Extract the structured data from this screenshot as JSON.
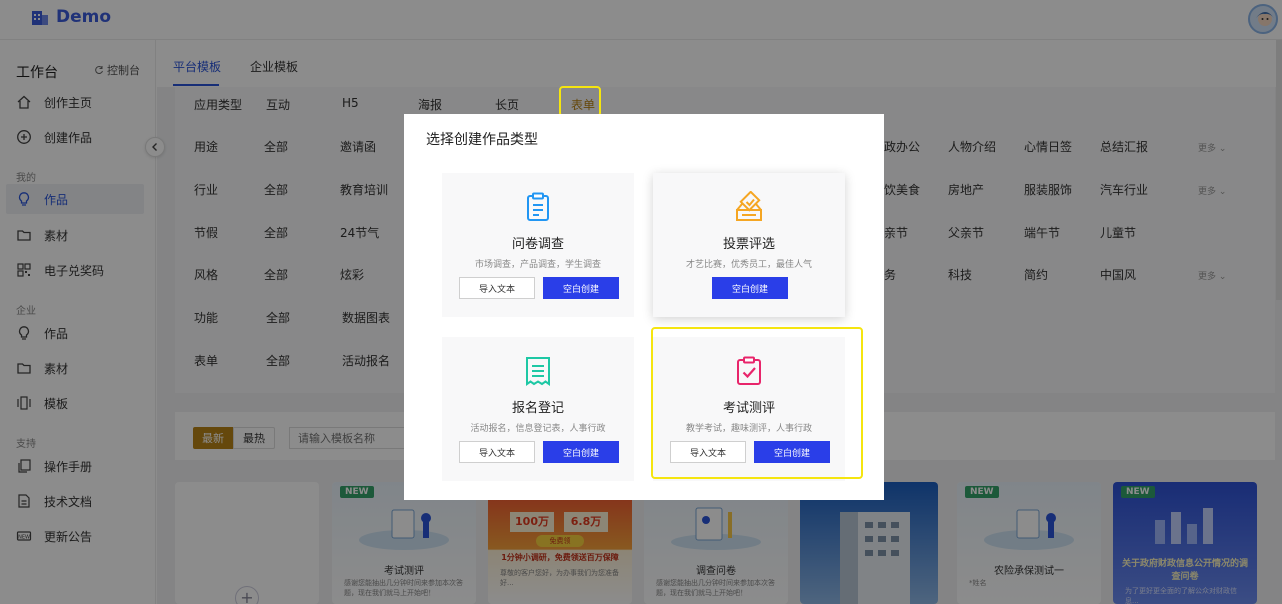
{
  "app": {
    "name": "Demo"
  },
  "sidebar": {
    "workspace_title": "工作台",
    "console_label": "控制台",
    "items_top": [
      {
        "label": "创作主页",
        "icon": "home-icon"
      },
      {
        "label": "创建作品",
        "icon": "plus-circle-icon"
      }
    ],
    "group_mine": "我的",
    "items_mine": [
      {
        "label": "作品",
        "icon": "bulb-icon",
        "active": true
      },
      {
        "label": "素材",
        "icon": "folder-icon"
      },
      {
        "label": "电子兑奖码",
        "icon": "qrcode-icon"
      }
    ],
    "group_enterprise": "企业",
    "items_enterprise": [
      {
        "label": "作品",
        "icon": "bulb-icon"
      },
      {
        "label": "素材",
        "icon": "folder-icon"
      },
      {
        "label": "模板",
        "icon": "template-icon"
      }
    ],
    "group_support": "支持",
    "items_support": [
      {
        "label": "操作手册",
        "icon": "copy-icon"
      },
      {
        "label": "技术文档",
        "icon": "doc-icon"
      },
      {
        "label": "更新公告",
        "icon": "new-icon"
      }
    ]
  },
  "tabs": [
    {
      "label": "平台模板",
      "active": true
    },
    {
      "label": "企业模板",
      "active": false
    }
  ],
  "filters": {
    "app_type_label": "应用类型",
    "app_types": [
      "互动",
      "H5",
      "海报",
      "长页",
      "表单"
    ],
    "rows": [
      {
        "label": "用途",
        "all": "全部",
        "first": "邀请函",
        "right": [
          "政办公",
          "人物介绍",
          "心情日签",
          "总结汇报"
        ],
        "more": "更多"
      },
      {
        "label": "行业",
        "all": "全部",
        "first": "教育培训",
        "right": [
          "饮美食",
          "房地产",
          "服装服饰",
          "汽车行业"
        ],
        "more": "更多"
      },
      {
        "label": "节假",
        "all": "全部",
        "first": "24节气",
        "right": [
          "亲节",
          "父亲节",
          "端午节",
          "儿童节"
        ],
        "more": ""
      },
      {
        "label": "风格",
        "all": "全部",
        "first": "炫彩",
        "right": [
          "务",
          "科技",
          "简约",
          "中国风"
        ],
        "more": "更多"
      },
      {
        "label": "功能",
        "all": "全部",
        "first": "数据图表",
        "right": [],
        "more": ""
      },
      {
        "label": "表单",
        "all": "全部",
        "first": "活动报名",
        "right": [],
        "more": ""
      }
    ]
  },
  "sort": {
    "latest": "最新",
    "hot": "最热",
    "search_placeholder": "请输入模板名称"
  },
  "cards": [
    {
      "badge": "NEW",
      "title": "考试测评",
      "desc": "感谢您能抽出几分钟时间来参加本次答题，现在我们就马上开始吧！"
    },
    {
      "badge": "",
      "title": "1分钟小调研，免费领送百万保障",
      "desc": "尊敬的客户您好，为办事我们为您准备好...",
      "amount1": "100万",
      "amount2": "6.8万",
      "free": "免费领"
    },
    {
      "badge": "",
      "title": "调查问卷",
      "desc": "感谢您能抽出几分钟时间来参加本次答题，现在我们就马上开始吧！"
    },
    {
      "badge": "",
      "title": "",
      "desc": ""
    },
    {
      "badge": "NEW",
      "title": "农险承保测试一",
      "desc": "*姓名"
    },
    {
      "badge": "NEW",
      "title": "关于政府财政信息公开情况的调查问卷",
      "desc": "为了更好更全面的了解公众对财政信息..."
    }
  ],
  "dialog": {
    "title": "选择创建作品类型",
    "options": [
      {
        "title": "问卷调查",
        "desc": "市场调查，产品调查，学生调查",
        "import": "导入文本",
        "create": "空白创建",
        "icon": "clipboard-icon",
        "color": "#2196f3"
      },
      {
        "title": "投票评选",
        "desc": "才艺比赛，优秀员工，最佳人气",
        "import": "",
        "create": "空白创建",
        "icon": "vote-box-icon",
        "color": "#f5a623"
      },
      {
        "title": "报名登记",
        "desc": "活动报名，信息登记表，人事行政",
        "import": "导入文本",
        "create": "空白创建",
        "icon": "receipt-icon",
        "color": "#1ec8a5"
      },
      {
        "title": "考试测评",
        "desc": "教学考试，趣味测评，人事行政",
        "import": "导入文本",
        "create": "空白创建",
        "icon": "exam-check-icon",
        "color": "#e8256b"
      }
    ]
  }
}
